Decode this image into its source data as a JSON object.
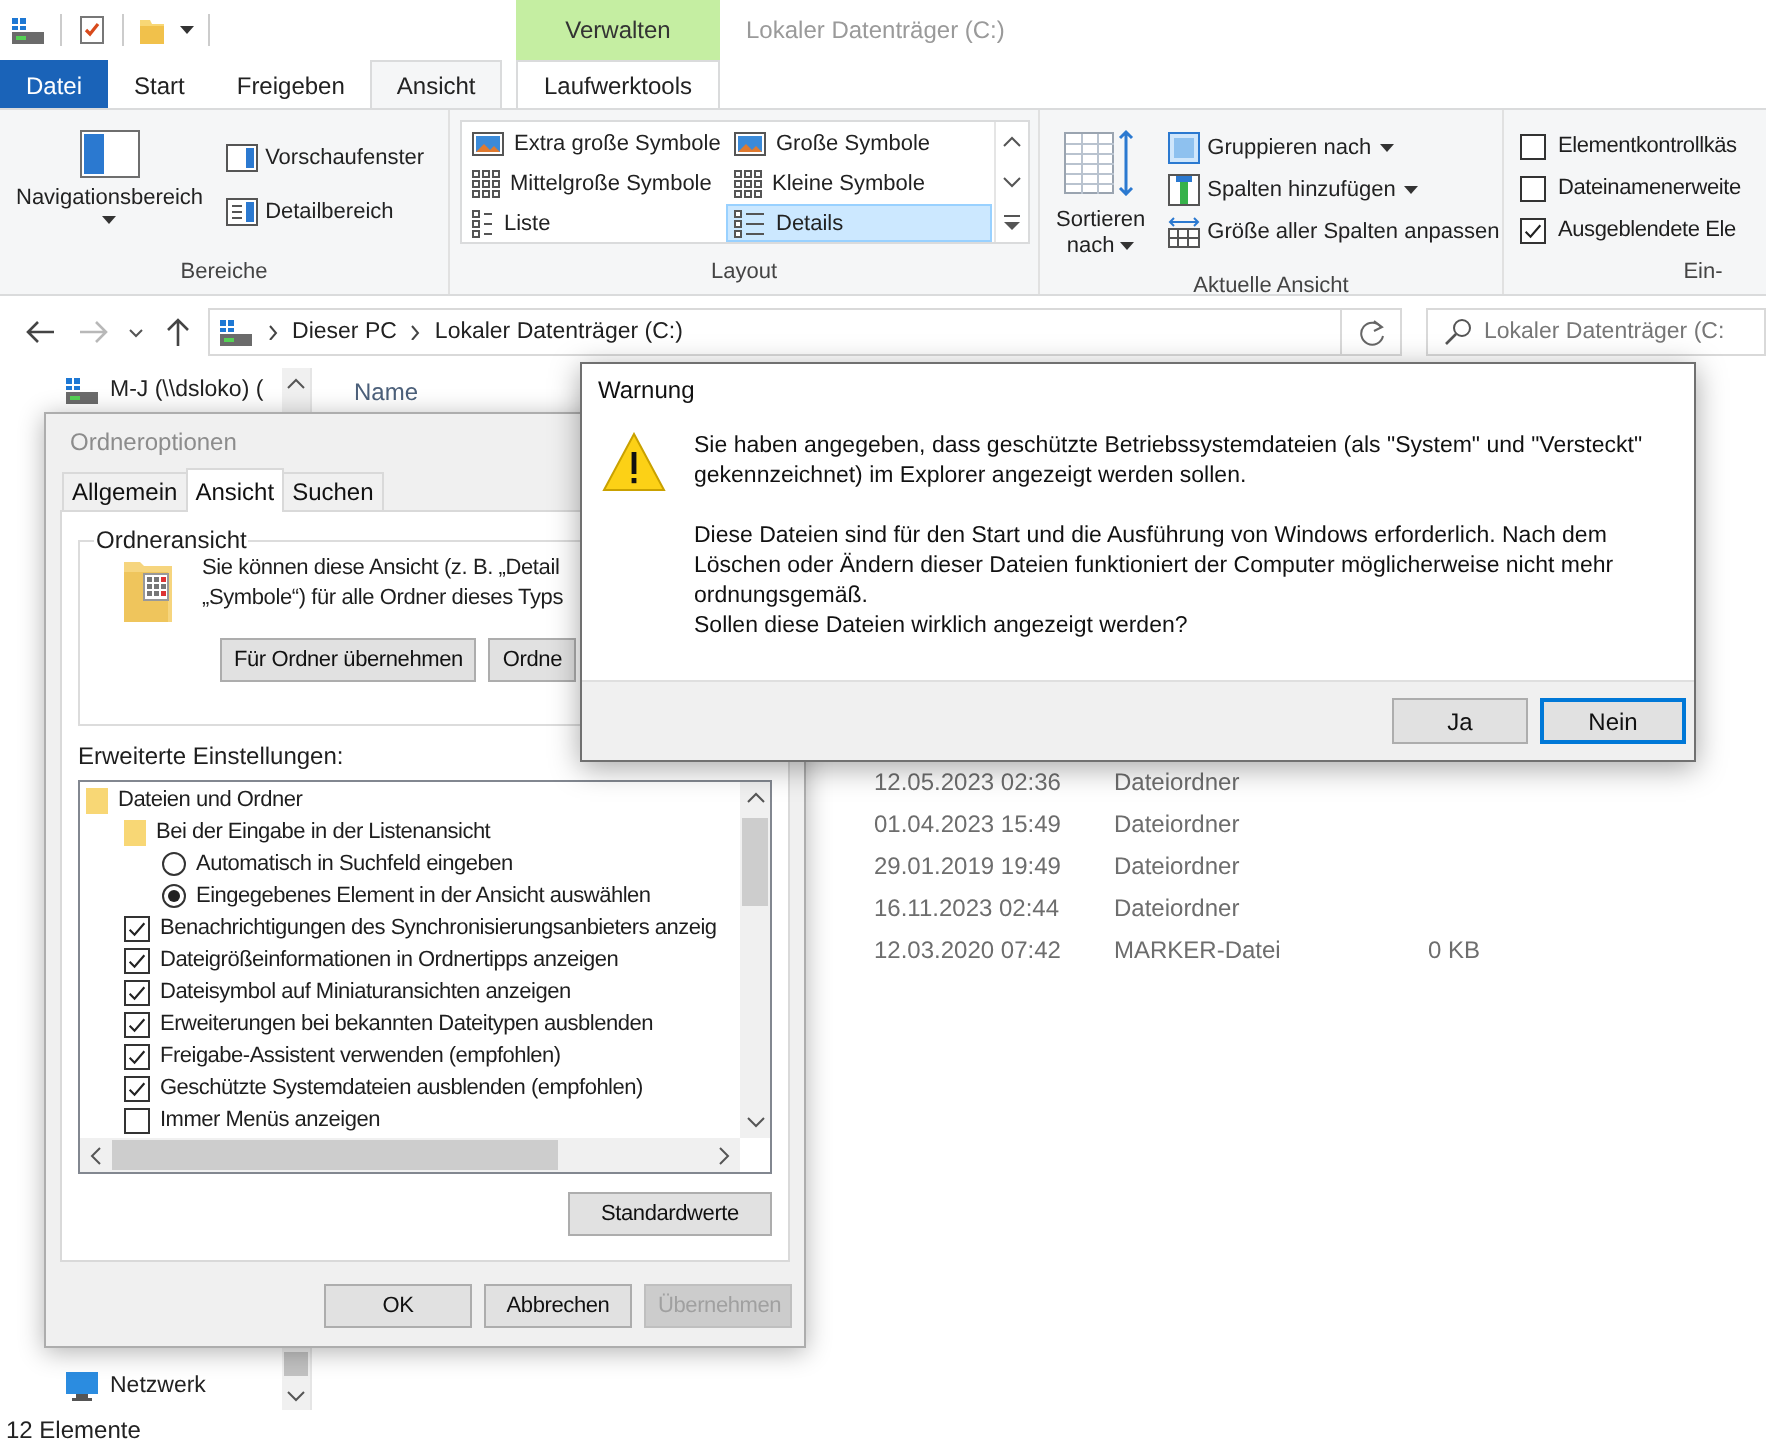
{
  "window": {
    "title": "Lokaler Datenträger (C:)"
  },
  "ribbon": {
    "context_header": "Verwalten",
    "tabs": [
      {
        "label": "Datei",
        "kind": "file",
        "selected": false
      },
      {
        "label": "Start",
        "kind": "normal",
        "selected": false
      },
      {
        "label": "Freigeben",
        "kind": "normal",
        "selected": false
      },
      {
        "label": "Ansicht",
        "kind": "normal",
        "selected": true
      },
      {
        "label": "Laufwerktools",
        "kind": "context",
        "selected": false
      }
    ],
    "panes": {
      "label": "Bereiche",
      "navigation_pane": "Navigationsbereich",
      "preview_pane": "Vorschaufenster",
      "details_pane": "Detailbereich"
    },
    "layout": {
      "label": "Layout",
      "options": [
        {
          "label": "Extra große Symbole",
          "kind": "picture",
          "selected": false
        },
        {
          "label": "Große Symbole",
          "kind": "picture",
          "selected": false
        },
        {
          "label": "Mittelgroße Symbole",
          "kind": "grid",
          "selected": false
        },
        {
          "label": "Kleine Symbole",
          "kind": "grid",
          "selected": false
        },
        {
          "label": "Liste",
          "kind": "list",
          "selected": false
        },
        {
          "label": "Details",
          "kind": "details",
          "selected": true
        }
      ]
    },
    "current_view": {
      "label": "Aktuelle Ansicht",
      "sort_by": "Sortieren nach",
      "group_by": "Gruppieren nach",
      "add_columns": "Spalten hinzufügen",
      "size_columns": "Größe aller Spalten anpassen"
    },
    "show_hide": {
      "label": "Ein-",
      "options": [
        {
          "label": "Elementkontrollkäs",
          "checked": false
        },
        {
          "label": "Dateinamenerweite",
          "checked": false
        },
        {
          "label": "Ausgeblendete Ele",
          "checked": true
        }
      ]
    }
  },
  "address_bar": {
    "path": [
      "Dieser PC",
      "Lokaler Datenträger (C:)"
    ],
    "search": {
      "placeholder": "Lokaler Datenträger (C:"
    }
  },
  "navigation_pane": {
    "items": [
      {
        "label": "M-J (\\\\dsloko) (",
        "kind": "network_drive"
      },
      {
        "label": "Netzwerk",
        "kind": "network"
      }
    ]
  },
  "file_list": {
    "columns": [
      "Name"
    ],
    "rows": [
      {
        "modified": "12.05.2023 02:36",
        "type": "Dateiordner"
      },
      {
        "modified": "01.04.2023 15:49",
        "type": "Dateiordner"
      },
      {
        "modified": "29.01.2019 19:49",
        "type": "Dateiordner"
      },
      {
        "modified": "16.11.2023 02:44",
        "type": "Dateiordner"
      },
      {
        "modified": "12.03.2020 07:42",
        "type": "MARKER-Datei",
        "size": "0 KB"
      }
    ]
  },
  "status_bar": {
    "item_count": "12 Elemente"
  },
  "folder_options": {
    "title": "Ordneroptionen",
    "tabs": [
      {
        "label": "Allgemein",
        "selected": false
      },
      {
        "label": "Ansicht",
        "selected": true
      },
      {
        "label": "Suchen",
        "selected": false
      }
    ],
    "folder_view": {
      "label": "Ordneransicht",
      "text_lines": [
        "Sie können diese Ansicht (z. B. „Detail",
        "„Symbole“) für alle Ordner dieses Typs"
      ],
      "buttons": [
        "Für Ordner übernehmen",
        "Ordne"
      ]
    },
    "advanced_label": "Erweiterte Einstellungen:",
    "settings": [
      {
        "label": "Dateien und Ordner",
        "kind": "folder",
        "children": [
          {
            "label": "Bei der Eingabe in der Listenansicht",
            "kind": "folder",
            "children": [
              {
                "label": "Automatisch in Suchfeld eingeben",
                "kind": "radio",
                "selected": false
              },
              {
                "label": "Eingegebenes Element in der Ansicht auswählen",
                "kind": "radio",
                "selected": true
              }
            ]
          },
          {
            "label": "Benachrichtigungen des Synchronisierungsanbieters anzeig",
            "kind": "checkbox",
            "checked": true
          },
          {
            "label": "Dateigrößeinformationen in Ordnertipps anzeigen",
            "kind": "checkbox",
            "checked": true
          },
          {
            "label": "Dateisymbol auf Miniaturansichten anzeigen",
            "kind": "checkbox",
            "checked": true
          },
          {
            "label": "Erweiterungen bei bekannten Dateitypen ausblenden",
            "kind": "checkbox",
            "checked": true
          },
          {
            "label": "Freigabe-Assistent verwenden (empfohlen)",
            "kind": "checkbox",
            "checked": true
          },
          {
            "label": "Geschützte Systemdateien ausblenden (empfohlen)",
            "kind": "checkbox",
            "checked": true
          },
          {
            "label": "Immer Menüs anzeigen",
            "kind": "checkbox",
            "checked": false
          }
        ]
      }
    ],
    "restore_defaults": "Standardwerte",
    "buttons": [
      {
        "label": "OK",
        "disabled": false
      },
      {
        "label": "Abbrechen",
        "disabled": false
      },
      {
        "label": "Übernehmen",
        "disabled": true
      }
    ]
  },
  "warning": {
    "title": "Warnung",
    "paragraphs": [
      "Sie haben angegeben, dass geschützte Betriebssystemdateien (als \"System\" und \"Versteckt\" gekennzeichnet) im Explorer angezeigt werden sollen.",
      "Diese Dateien sind für den Start und die Ausführung von Windows erforderlich. Nach dem Löschen oder Ändern dieser Dateien funktioniert der Computer möglicherweise nicht mehr ordnungsgemäß.",
      "Sollen diese Dateien wirklich angezeigt werden?"
    ],
    "buttons": [
      {
        "label": "Ja",
        "default": false
      },
      {
        "label": "Nein",
        "default": true
      }
    ]
  }
}
